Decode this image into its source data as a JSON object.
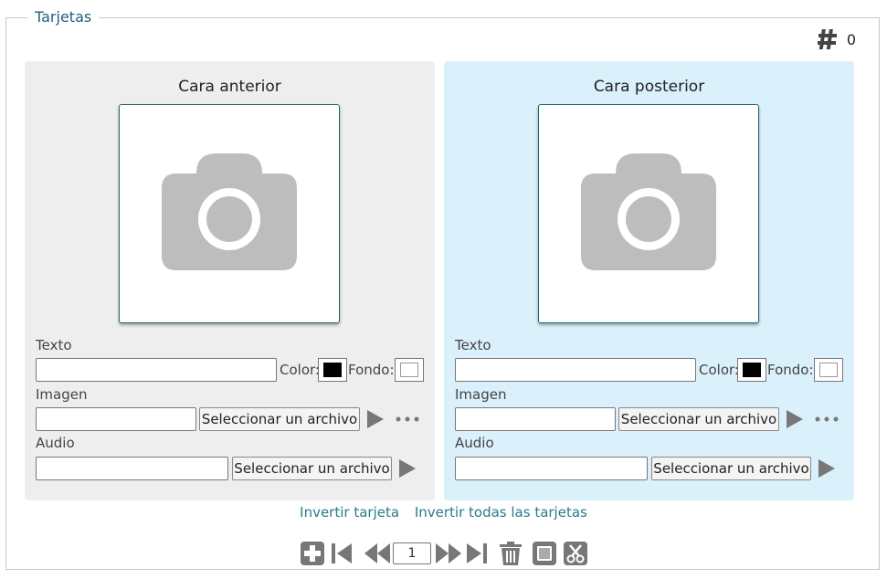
{
  "fieldset": {
    "legend": "Tarjetas",
    "count": "0"
  },
  "front": {
    "title": "Cara anterior",
    "text_label": "Texto",
    "color_label": "Color:",
    "bg_label": "Fondo:",
    "image_label": "Imagen",
    "audio_label": "Audio",
    "select_file": "Seleccionar un archivo",
    "text_color": "#000000",
    "bg_color": "#ffffff"
  },
  "back": {
    "title": "Cara posterior",
    "text_label": "Texto",
    "color_label": "Color:",
    "bg_label": "Fondo:",
    "image_label": "Imagen",
    "audio_label": "Audio",
    "select_file": "Seleccionar un archivo",
    "text_color": "#000000",
    "bg_color": "#ffffff"
  },
  "links": {
    "invert_card": "Invertir tarjeta",
    "invert_all": "Invertir todas las tarjetas"
  },
  "pager": {
    "page": "1"
  },
  "icons": {
    "count": "hash-icon",
    "placeholder": "camera-icon",
    "play": "play-icon",
    "more": "more-dots-icon",
    "add": "add-icon",
    "first": "first-page-icon",
    "prev": "previous-icon",
    "next": "next-icon",
    "last": "last-page-icon",
    "delete": "trash-icon",
    "copy": "copy-icon",
    "cut": "cut-icon"
  },
  "colors": {
    "accent": "#1f5f7a",
    "link": "#2a7a8c",
    "front_bg": "#eeeeee",
    "back_bg": "#daf0fb",
    "icon_gray": "#777777"
  }
}
